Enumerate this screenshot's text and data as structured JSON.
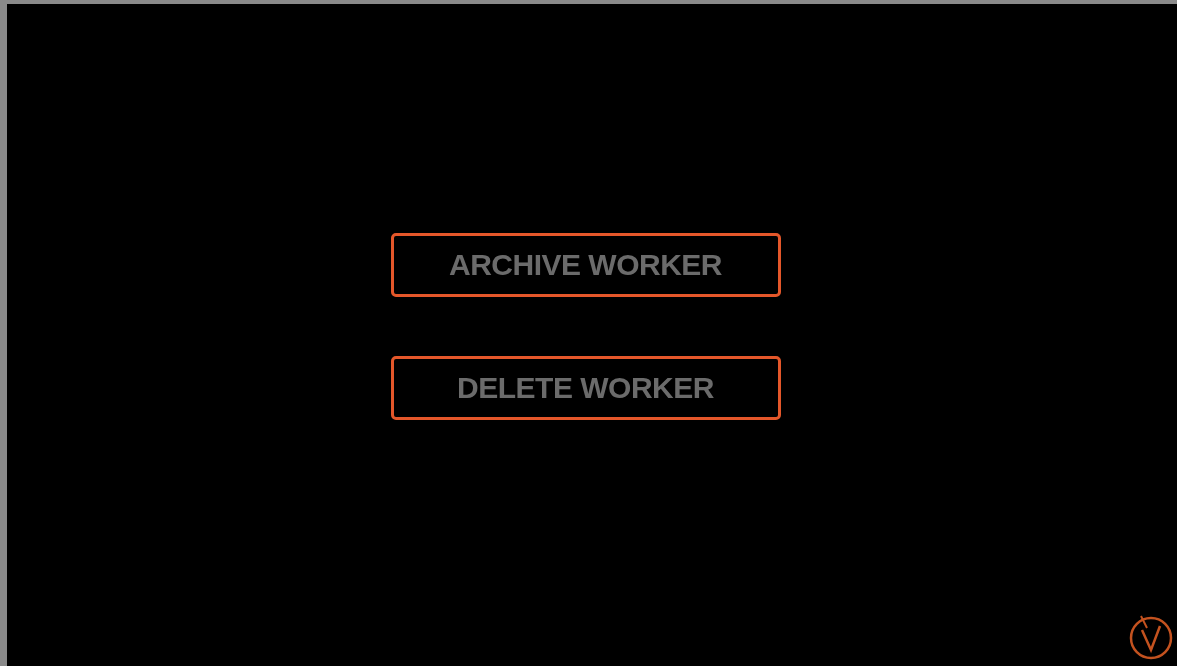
{
  "buttons": [
    {
      "label": "ARCHIVE WORKER"
    },
    {
      "label": "DELETE WORKER"
    }
  ]
}
